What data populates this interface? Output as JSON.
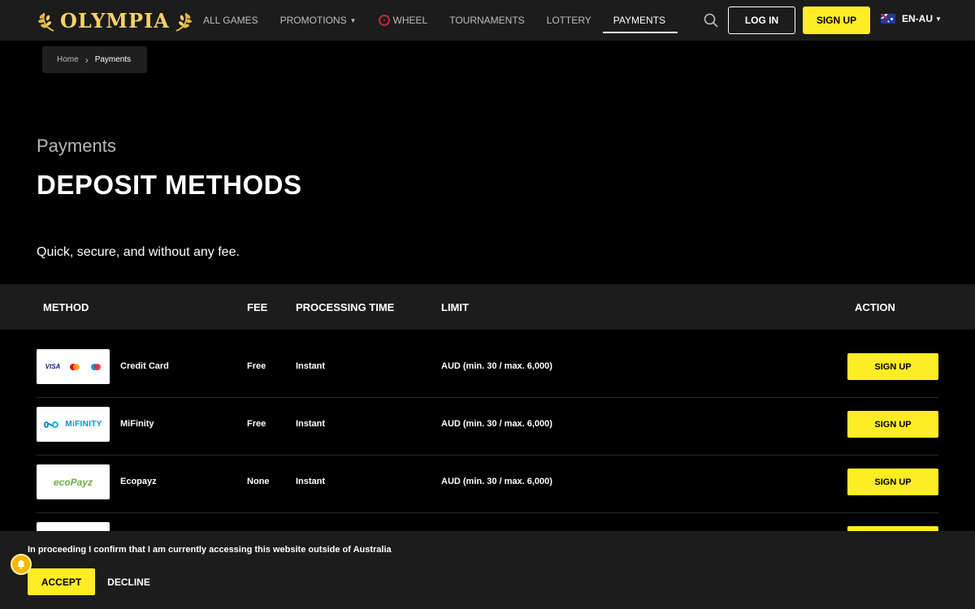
{
  "header": {
    "logo_text": "OLYMPIA",
    "nav": [
      {
        "label": "ALL GAMES"
      },
      {
        "label": "PROMOTIONS"
      },
      {
        "label": "WHEEL"
      },
      {
        "label": "TOURNAMENTS"
      },
      {
        "label": "LOTTERY"
      },
      {
        "label": "PAYMENTS"
      }
    ],
    "login_label": "LOG IN",
    "signup_label": "SIGN UP",
    "language": "EN-AU"
  },
  "breadcrumb": {
    "home": "Home",
    "current": "Payments"
  },
  "hero": {
    "subtitle": "Payments",
    "title": "DEPOSIT METHODS",
    "tagline": "Quick, secure, and without any fee."
  },
  "table": {
    "headers": {
      "method": "METHOD",
      "fee": "FEE",
      "processing": "PROCESSING TIME",
      "limit": "LIMIT",
      "action": "ACTION"
    },
    "rows": [
      {
        "method": "Credit Card",
        "fee": "Free",
        "processing": "Instant",
        "limit": "AUD (min. 30 / max. 6,000)",
        "action": "SIGN UP",
        "logo_text": "VISA"
      },
      {
        "method": "MiFinity",
        "fee": "Free",
        "processing": "Instant",
        "limit": "AUD (min. 30 / max. 6,000)",
        "action": "SIGN UP",
        "logo_text": "MiFINITY"
      },
      {
        "method": "Ecopayz",
        "fee": "None",
        "processing": "Instant",
        "limit": "AUD (min. 30 / max. 6,000)",
        "action": "SIGN UP",
        "logo_text": "ecoPayz"
      }
    ]
  },
  "consent": {
    "text": "In proceeding I confirm that I am currently accessing this website outside of Australia",
    "accept_label": "ACCEPT",
    "decline_label": "DECLINE"
  },
  "colors": {
    "accent": "#ffed23",
    "header_bg": "#1c1c1c",
    "page_bg": "#000000",
    "logo_gold": "#f5d26b"
  }
}
